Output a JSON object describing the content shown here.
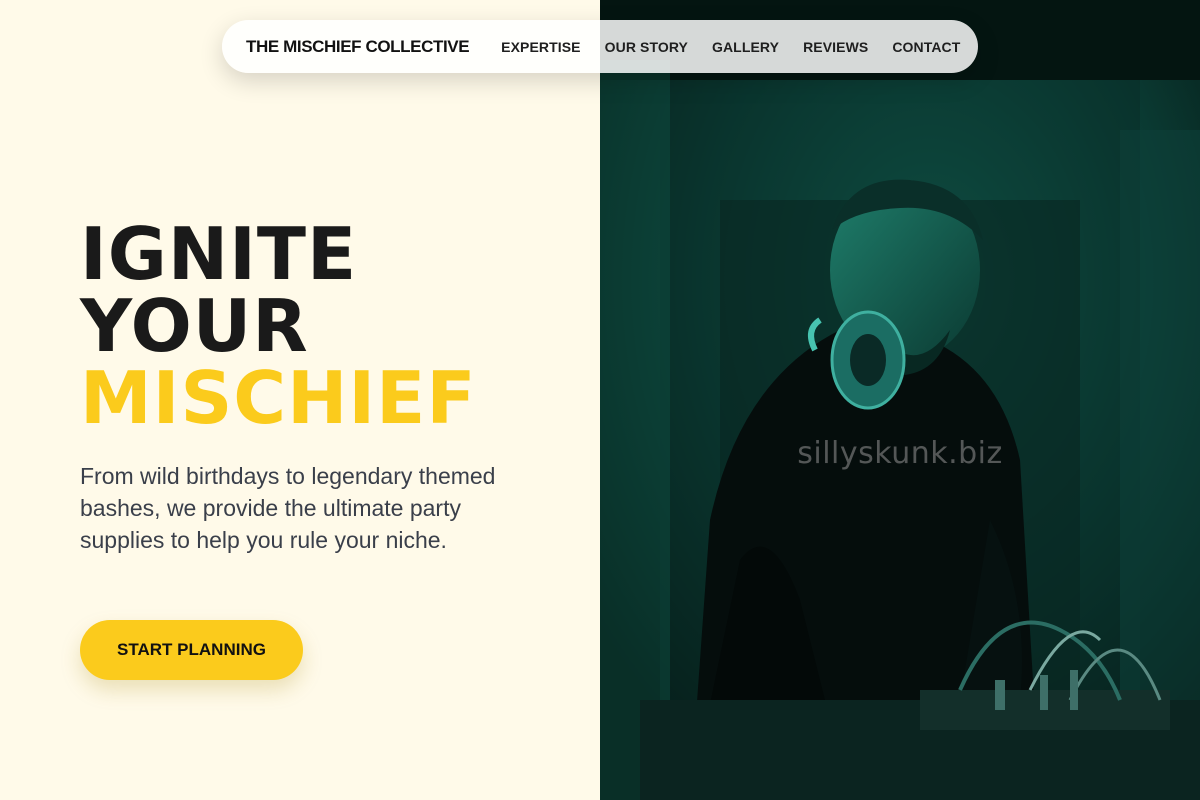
{
  "nav": {
    "brand": "THE MISCHIEF COLLECTIVE",
    "links": [
      "EXPERTISE",
      "OUR STORY",
      "GALLERY",
      "REVIEWS",
      "CONTACT"
    ]
  },
  "hero": {
    "headline": [
      "IGNITE",
      "YOUR",
      "MISCHIEF"
    ],
    "subtitle": "From wild birthdays to legendary themed bashes, we provide the ultimate party supplies to help you rule your niche.",
    "cta_label": "START PLANNING"
  },
  "image": {
    "alt": "DJ wearing headphones mixing at a console",
    "watermark": "sillyskunk.biz"
  },
  "colors": {
    "background": "#fffae9",
    "accent": "#fbcb1c",
    "text": "#1a1a1a",
    "photo_tint": "#0e4a40"
  }
}
